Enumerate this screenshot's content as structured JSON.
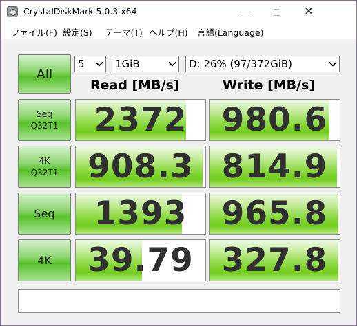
{
  "window": {
    "title": "CrystalDiskMark 5.0.3 x64",
    "accent_color": "#8a6aa6",
    "controls": {
      "minimize_icon": "minimize-icon",
      "maximize_icon": "maximize-icon",
      "close_glyph": "✕"
    }
  },
  "menu": {
    "file": "ファイル(F)",
    "settings": "設定(S)",
    "theme": "テーマ(T)",
    "help": "ヘルプ(H)",
    "language": "言語(Language)"
  },
  "controls": {
    "all_button": "All",
    "test_count": "5",
    "test_size": "1GiB",
    "drive": "D: 26% (97/372GiB)"
  },
  "headers": {
    "read": "Read [MB/s]",
    "write": "Write [MB/s]"
  },
  "rows": [
    {
      "label_line1": "Seq",
      "label_line2": "Q32T1",
      "read": "2372",
      "write": "980.6",
      "read_fill": 0.85,
      "write_fill": 0.92
    },
    {
      "label_line1": "4K",
      "label_line2": "Q32T1",
      "read": "908.3",
      "write": "814.9",
      "read_fill": 0.98,
      "write_fill": 0.98
    },
    {
      "label_line1": "Seq",
      "label_line2": "",
      "read": "1393",
      "write": "965.8",
      "read_fill": 0.82,
      "write_fill": 0.99
    },
    {
      "label_line1": "4K",
      "label_line2": "",
      "read": "39.79",
      "write": "327.8",
      "read_fill": 0.51,
      "write_fill": 0.99
    }
  ],
  "status": {
    "message": ""
  },
  "colors": {
    "bar_green": "#72cc1f",
    "button_green": "#58c12a"
  }
}
